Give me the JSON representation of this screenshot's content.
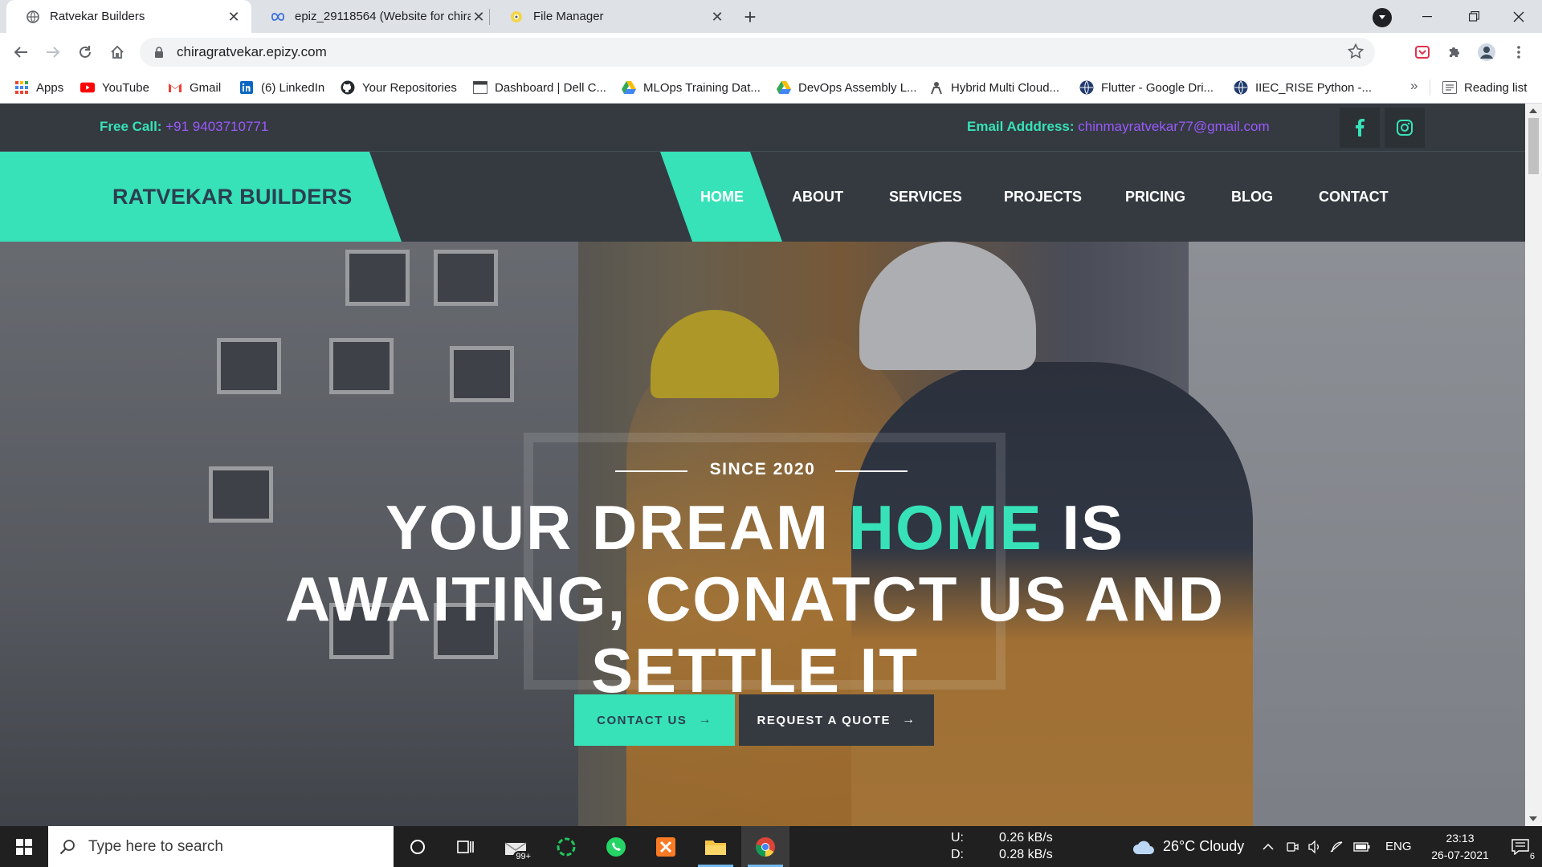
{
  "browser": {
    "tabs": [
      {
        "title": "Ratvekar Builders",
        "active": true,
        "icon": "globe-icon"
      },
      {
        "title": "epiz_29118564 (Website for chira",
        "active": false,
        "icon": "infinity-icon"
      },
      {
        "title": "File Manager",
        "active": false,
        "icon": "file-manager-icon"
      }
    ],
    "new_tab_label": "+",
    "url": "chiragratvekar.epizy.com",
    "bookmarks": [
      {
        "label": "Apps",
        "icon": "apps-grid-icon"
      },
      {
        "label": "YouTube",
        "icon": "youtube-icon"
      },
      {
        "label": "Gmail",
        "icon": "gmail-icon"
      },
      {
        "label": "(6) LinkedIn",
        "icon": "linkedin-icon"
      },
      {
        "label": "Your Repositories",
        "icon": "github-icon"
      },
      {
        "label": "Dashboard | Dell C...",
        "icon": "page-icon"
      },
      {
        "label": "MLOps Training Dat...",
        "icon": "google-drive-icon"
      },
      {
        "label": "DevOps Assembly L...",
        "icon": "google-drive-icon"
      },
      {
        "label": "Hybrid Multi Cloud...",
        "icon": "person-icon"
      },
      {
        "label": "Flutter - Google Dri...",
        "icon": "globe-icon"
      },
      {
        "label": "IIEC_RISE Python -...",
        "icon": "globe-icon"
      }
    ],
    "bookmarks_more": "»",
    "reading_list": "Reading list"
  },
  "site": {
    "topbar": {
      "call_label": "Free Call:",
      "call_value": "+91 9403710771",
      "email_label": "Email Adddress:",
      "email_value": "chinmayratvekar77@gmail.com"
    },
    "brand": "RATVEKAR BUILDERS",
    "nav": [
      "HOME",
      "ABOUT",
      "SERVICES",
      "PROJECTS",
      "PRICING",
      "BLOG",
      "CONTACT"
    ],
    "active_nav": "HOME",
    "hero": {
      "since": "SINCE 2020",
      "headline_before": "YOUR DREAM ",
      "headline_accent": "HOME",
      "headline_after": " IS AWAITING, CONATCT US AND SETTLE IT",
      "primary_button": "CONTACT US",
      "secondary_button": "REQUEST A QUOTE",
      "arrow": "→"
    },
    "colors": {
      "accent": "#37e2b8",
      "dark": "#343a40",
      "link": "#9b59ff"
    }
  },
  "taskbar": {
    "search_placeholder": "Type here to search",
    "mail_badge": "99+",
    "net_up_label": "U:",
    "net_up_value": "0.26 kB/s",
    "net_down_label": "D:",
    "net_down_value": "0.28 kB/s",
    "weather": "26°C  Cloudy",
    "language": "ENG",
    "time": "23:13",
    "date": "26-07-2021",
    "notifications": "6"
  }
}
